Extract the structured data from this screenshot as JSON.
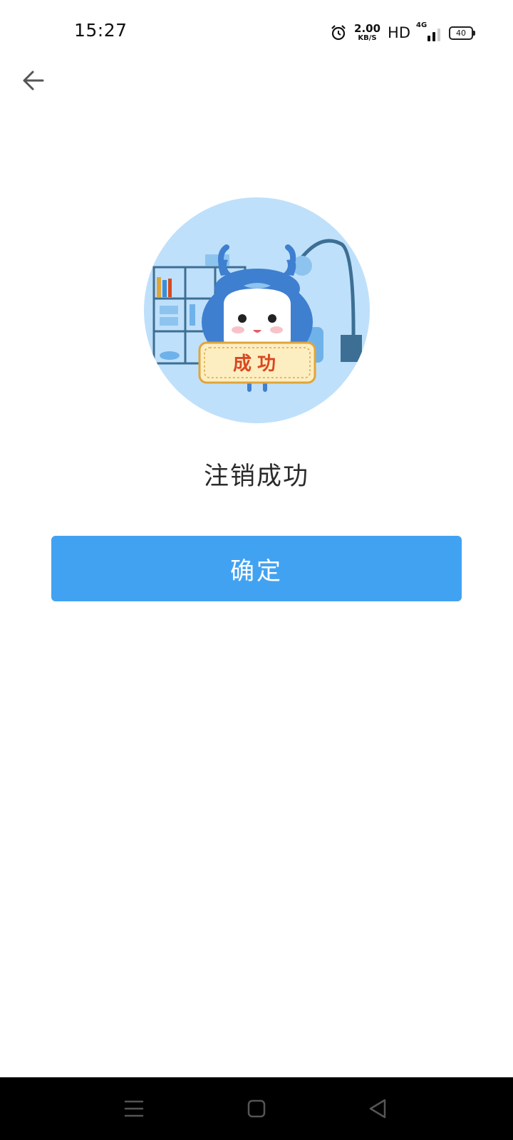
{
  "status_bar": {
    "time": "15:27",
    "net_speed_value": "2.00",
    "net_speed_unit": "KB/S",
    "hd": "HD",
    "network": "4G",
    "battery": "40",
    "icons": [
      "alarm-icon",
      "signal-icon",
      "battery-icon"
    ]
  },
  "nav": {
    "back_icon": "arrow-left-icon"
  },
  "illustration": {
    "sign_text": "成功",
    "colors": {
      "circle": "#bfe0fb",
      "mascot": "#3f7fd0",
      "sign": "#fdeec2",
      "sign_text": "#d9481f"
    }
  },
  "result": {
    "title": "注销成功"
  },
  "actions": {
    "confirm_label": "确定",
    "confirm_color": "#42a2f2"
  },
  "system_nav": {
    "icons": [
      "menu-icon",
      "home-icon",
      "back-triangle-icon"
    ]
  }
}
